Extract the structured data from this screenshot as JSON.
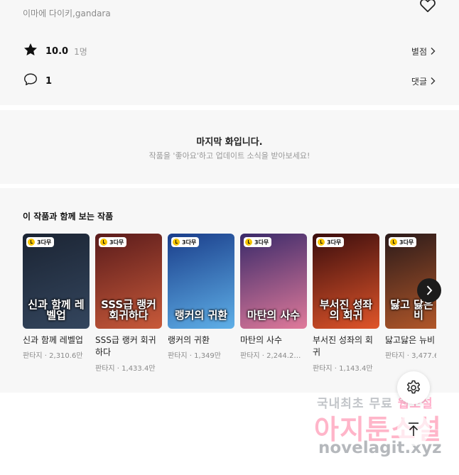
{
  "work": {
    "authors": "이마에 다이키,gandara",
    "rating_score": "10.0",
    "rating_count": "1명",
    "rating_link": "별점",
    "comment_count": "1",
    "comment_link": "댓글"
  },
  "last_episode": {
    "title": "마지막 화입니다.",
    "subtitle": "작품을 '좋아요'하고 업데이트 소식을 받아보세요!"
  },
  "recommendations": {
    "heading": "이 작품과 함께 보는 작품",
    "items": [
      {
        "title": "신과 함께 레벨업",
        "genre": "판타지",
        "views": "2,310.6만",
        "badge": "3다무",
        "cover_text": "신과 함께 레벨업",
        "colors": [
          "#1b2433",
          "#34465e"
        ]
      },
      {
        "title": "SSS급 랭커 회귀하다",
        "genre": "판타지",
        "views": "1,433.4만",
        "badge": "3다무",
        "cover_text": "SSS급 랭커 회귀하다",
        "colors": [
          "#5a1b1b",
          "#c85a3a"
        ]
      },
      {
        "title": "랭커의 귀환",
        "genre": "판타지",
        "views": "1,349만",
        "badge": "3다무",
        "cover_text": "랭커의 귀환",
        "colors": [
          "#1a3d8a",
          "#5fb0e8"
        ]
      },
      {
        "title": "마탄의 사수",
        "genre": "판타지",
        "views": "2,244.2…",
        "badge": "3다무",
        "cover_text": "마탄의 사수",
        "colors": [
          "#3a2a6a",
          "#e07a9a"
        ]
      },
      {
        "title": "부서진 성좌의 회귀",
        "genre": "판타지",
        "views": "1,143.4만",
        "badge": "3다무",
        "cover_text": "부서진 성좌의 회귀",
        "colors": [
          "#3a0d0d",
          "#e0552a"
        ]
      },
      {
        "title": "닳고닳은 뉴비",
        "genre": "판타지",
        "views": "3,477.6…",
        "badge": "3다무",
        "cover_text": "닳고 닳은 뉴비",
        "colors": [
          "#2a1a1a",
          "#b85a2a"
        ]
      }
    ]
  },
  "watermark": {
    "line1_a": "국내최초 무료",
    "line1_b": "웹소설",
    "line2": "아지툰소설",
    "line3": "novelagit.xyz"
  },
  "icons": {
    "heart": "heart-icon",
    "star": "star-icon",
    "comment": "comment-icon",
    "chevron": "chevron-right-icon",
    "gear": "gear-icon",
    "up": "arrow-up-icon"
  }
}
